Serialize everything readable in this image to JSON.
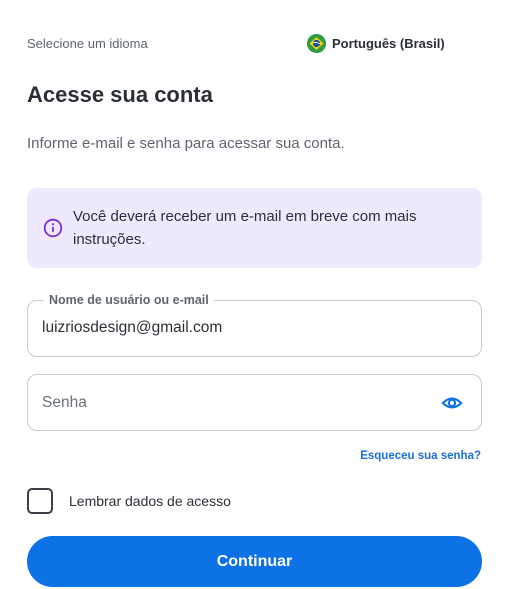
{
  "language": {
    "label": "Selecione um idioma",
    "selected": "Português (Brasil)",
    "flag_icon": "brazil-flag-icon"
  },
  "header": {
    "title": "Acesse sua conta",
    "subtitle": "Informe e-mail e senha para acessar sua conta."
  },
  "alert": {
    "icon": "info-circle-icon",
    "text": "Você deverá receber um e-mail em breve com mais instruções.",
    "background": "#efe9fd",
    "icon_color": "#7b2fd0"
  },
  "form": {
    "username": {
      "label": "Nome de usuário ou e-mail",
      "value": "luizriosdesign@gmail.com"
    },
    "password": {
      "placeholder": "Senha",
      "value": "",
      "toggle_icon": "eye-icon"
    },
    "forgot_link": "Esqueceu sua senha?",
    "remember": {
      "label": "Lembrar dados de acesso",
      "checked": false
    },
    "submit_label": "Continuar"
  },
  "colors": {
    "primary": "#0d72e6",
    "link": "#1a6fd8",
    "text": "#2b2f36",
    "muted": "#5f6570"
  }
}
